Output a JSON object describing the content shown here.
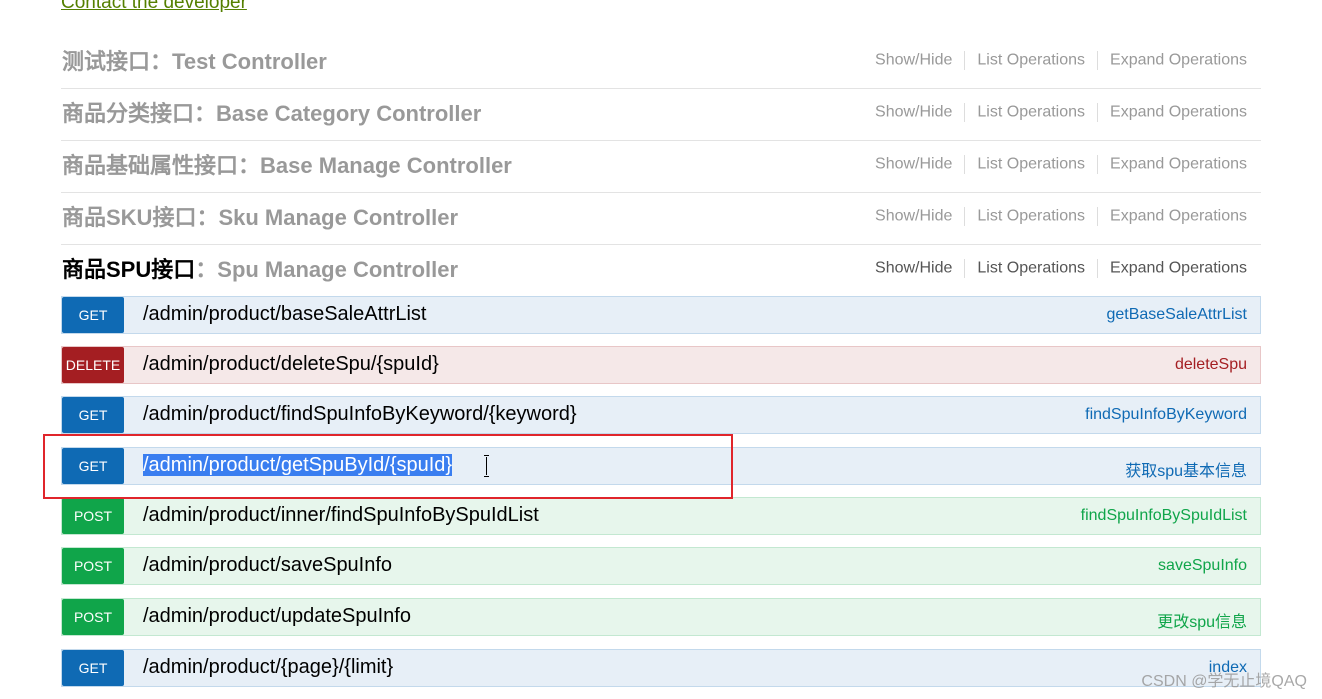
{
  "top_link": "Contact the developer",
  "resources": [
    {
      "cn": "测试接口",
      "sep": "：",
      "en": "Test Controller",
      "show_hide": "Show/Hide",
      "list_ops": "List Operations",
      "expand_ops": "Expand Operations"
    },
    {
      "cn": "商品分类接口",
      "sep": "：",
      "en": "Base Category Controller",
      "show_hide": "Show/Hide",
      "list_ops": "List Operations",
      "expand_ops": "Expand Operations"
    },
    {
      "cn": "商品基础属性接口",
      "sep": "：",
      "en": "Base Manage Controller",
      "show_hide": "Show/Hide",
      "list_ops": "List Operations",
      "expand_ops": "Expand Operations"
    },
    {
      "cn": "商品SKU接口",
      "sep": "：",
      "en": "Sku Manage Controller",
      "show_hide": "Show/Hide",
      "list_ops": "List Operations",
      "expand_ops": "Expand Operations"
    },
    {
      "cn": "商品SPU接口",
      "sep": "：",
      "en": "Spu Manage Controller",
      "show_hide": "Show/Hide",
      "list_ops": "List Operations",
      "expand_ops": "Expand Operations"
    }
  ],
  "endpoints": [
    {
      "method": "GET",
      "path": "/admin/product/baseSaleAttrList",
      "summary": "getBaseSaleAttrList"
    },
    {
      "method": "DELETE",
      "path": "/admin/product/deleteSpu/{spuId}",
      "summary": "deleteSpu"
    },
    {
      "method": "GET",
      "path": "/admin/product/findSpuInfoByKeyword/{keyword}",
      "summary": "findSpuInfoByKeyword"
    },
    {
      "method": "GET",
      "path": "/admin/product/getSpuById/{spuId}",
      "summary": "获取spu基本信息"
    },
    {
      "method": "POST",
      "path": "/admin/product/inner/findSpuInfoBySpuIdList",
      "summary": "findSpuInfoBySpuIdList"
    },
    {
      "method": "POST",
      "path": "/admin/product/saveSpuInfo",
      "summary": "saveSpuInfo"
    },
    {
      "method": "POST",
      "path": "/admin/product/updateSpuInfo",
      "summary": "更改spu信息"
    },
    {
      "method": "GET",
      "path": "/admin/product/{page}/{limit}",
      "summary": "index"
    }
  ],
  "watermark": "CSDN @学无止境QAQ",
  "colors": {
    "get": "#0f6ab4",
    "delete": "#a41e22",
    "post": "#10a54a",
    "highlight": "#e0252b",
    "selection": "#3a7ef0"
  }
}
